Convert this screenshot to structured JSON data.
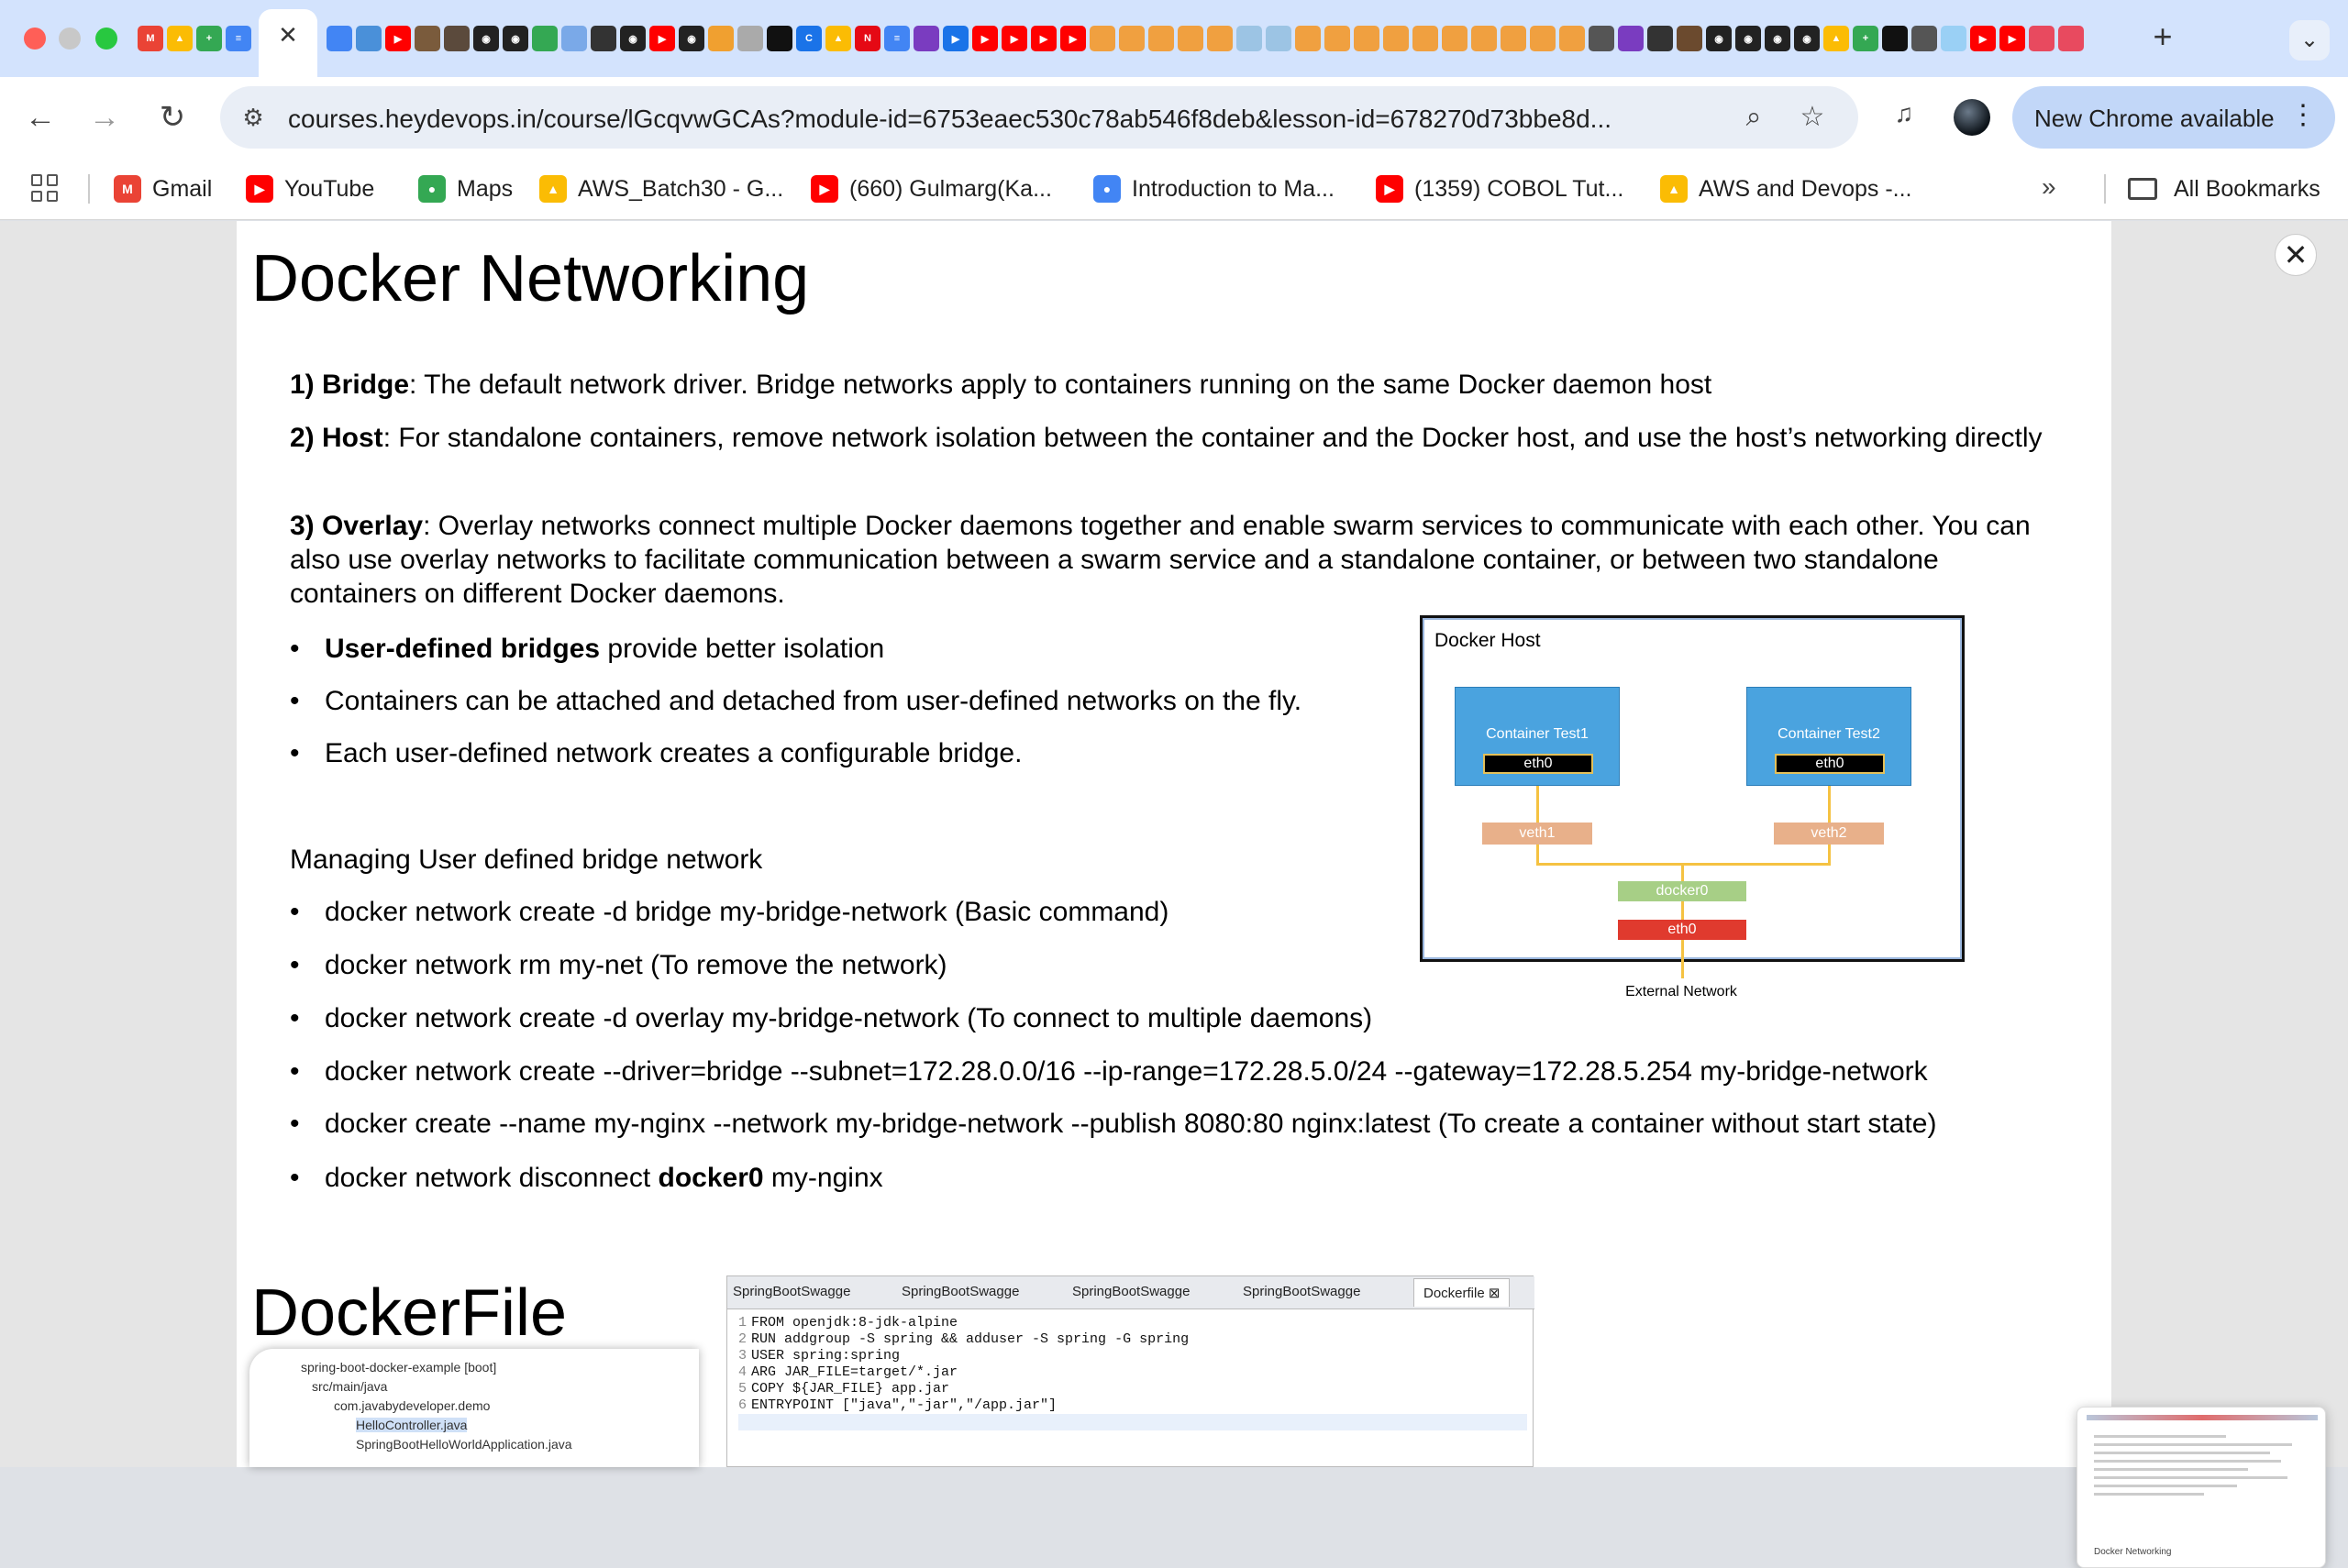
{
  "browser": {
    "active_tab_close": "✕",
    "new_tab": "+",
    "url": "courses.heydevops.in/course/lGcqvwGCAs?module-id=6753eaec530c78ab546f8deb&lesson-id=678270d73bbe8d...",
    "update_button": "New Chrome available",
    "bookmarks": [
      {
        "label": "Gmail",
        "icon": "gmail-icon",
        "color": "#ea4335"
      },
      {
        "label": "YouTube",
        "icon": "youtube-icon",
        "color": "#ff0000"
      },
      {
        "label": "Maps",
        "icon": "maps-icon",
        "color": "#34a853"
      },
      {
        "label": "AWS_Batch30 - G...",
        "icon": "drive-icon",
        "color": "#fbbc04"
      },
      {
        "label": "(660) Gulmarg(Ka...",
        "icon": "youtube-icon",
        "color": "#ff0000"
      },
      {
        "label": "Introduction to Ma...",
        "icon": "site-icon",
        "color": "#4285f4"
      },
      {
        "label": "(1359) COBOL Tut...",
        "icon": "youtube-icon",
        "color": "#ff0000"
      },
      {
        "label": "AWS and Devops -...",
        "icon": "drive-icon",
        "color": "#fbbc04"
      }
    ],
    "more_bookmarks": "»",
    "all_bookmarks": "All Bookmarks"
  },
  "slide": {
    "title": "Docker Networking",
    "items": [
      {
        "label": "1) Bridge",
        "text": ": The default network driver. Bridge networks apply to containers running on the same Docker daemon host"
      },
      {
        "label": "2) Host",
        "text": ": For standalone containers, remove network isolation between the container and the Docker host, and use the host’s networking directly"
      },
      {
        "label": "3) Overlay",
        "text": ": Overlay networks connect multiple Docker daemons together and enable swarm services to communicate with each other. You can also use overlay networks to facilitate communication between a swarm service and a standalone container, or between two standalone containers on different Docker daemons."
      }
    ],
    "bridge_points": [
      {
        "bold": "User-defined bridges",
        "rest": " provide better isolation"
      },
      {
        "bold": "",
        "rest": "Containers can be attached and detached from user-defined networks on the fly."
      },
      {
        "bold": "",
        "rest": "Each user-defined network creates a configurable bridge."
      }
    ],
    "managing_heading": "Managing User defined bridge network",
    "commands": [
      {
        "pre": "docker network create -d bridge my-bridge-network (Basic command)",
        "bold": "",
        "post": ""
      },
      {
        "pre": "docker network rm my-net (To remove the network)",
        "bold": "",
        "post": ""
      },
      {
        "pre": "docker network create -d overlay my-bridge-network (To connect to multiple daemons)",
        "bold": "",
        "post": ""
      },
      {
        "pre": "docker network create --driver=bridge --subnet=172.28.0.0/16 --ip-range=172.28.5.0/24 --gateway=172.28.5.254 my-bridge-network",
        "bold": "",
        "post": ""
      },
      {
        "pre": "docker create --name my-nginx  --network my-bridge-network --publish 8080:80 nginx:latest (To create a container without start state)",
        "bold": "",
        "post": ""
      },
      {
        "pre": "docker network disconnect ",
        "bold": "docker0",
        "post": " my-nginx"
      }
    ],
    "diagram": {
      "host_label": "Docker Host",
      "container1": "Container Test1",
      "container2": "Container Test2",
      "eth": "eth0",
      "veth1": "veth1",
      "veth2": "veth2",
      "bridge": "docker0",
      "host_eth": "eth0",
      "external": "External Network"
    },
    "title2": "DockerFile",
    "ide_tabs": [
      "SpringBootSwagge",
      "SpringBootSwagge",
      "SpringBootSwagge",
      "SpringBootSwagge",
      "Dockerfile ⊠"
    ],
    "dockerfile": [
      "FROM openjdk:8-jdk-alpine",
      "RUN addgroup -S spring && adduser -S spring -G spring",
      "USER spring:spring",
      "ARG JAR_FILE=target/*.jar",
      "COPY ${JAR_FILE} app.jar",
      "ENTRYPOINT [\"java\",\"-jar\",\"/app.jar\"]"
    ],
    "tree": [
      "spring-boot-docker-example [boot]",
      "src/main/java",
      "com.javabydeveloper.demo",
      "HelloController.java",
      "SpringBootHelloWorldApplication.java"
    ]
  },
  "thumbnail_caption": "Docker Networking"
}
